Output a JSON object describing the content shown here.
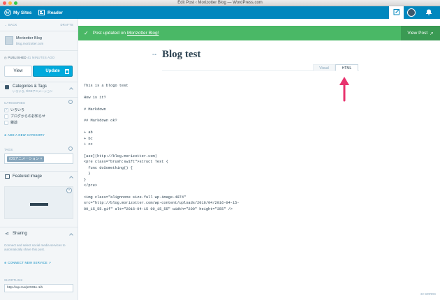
{
  "window": {
    "title": "Edit Post ‹ Morizotter Blog — WordPress.com"
  },
  "masterbar": {
    "my_sites": "My Sites",
    "reader": "Reader"
  },
  "sidebar": {
    "back": "BACK",
    "drafts": "DRAFTS",
    "site_name": "Morizotter Blog",
    "site_url": "blog.morizotter.com",
    "published_label": "PUBLISHED",
    "published_time": "41 MINUTES AGO",
    "view_label": "View",
    "update_label": "Update",
    "categories_title": "Categories & Tags",
    "categories_sub": "いろいろ, #iOSアニメーション",
    "categories_caps": "CATEGORIES",
    "categories": [
      {
        "label": "いろいろ",
        "checked": true
      },
      {
        "label": "ブログからのお知らせ",
        "checked": false
      },
      {
        "label": "雑談",
        "checked": false
      }
    ],
    "add_category": "ADD A NEW CATEGORY",
    "tags_caps": "TAGS",
    "tag": "iOSアニメーション",
    "featured_title": "Featured image",
    "sharing_title": "Sharing",
    "sharing_desc": "Connect and select social media services to automatically share this post.",
    "connect": "CONNECT NEW SERVICE",
    "shortlink_caps": "SHORTLINK",
    "shortlink": "http://wp.me/p2X9tA-1ih"
  },
  "notice": {
    "text": "Post updated on",
    "link": "Morizotter Blog!",
    "view_post": "View Post"
  },
  "editor": {
    "title": "Blog test",
    "tabs": [
      "Visual",
      "HTML"
    ],
    "active_tab": "HTML",
    "word_count": "22 WORDS",
    "content_lines": [
      "This is a blogo test",
      "",
      "How is it?",
      "",
      "# Markdown",
      "",
      "## Markdown ok?",
      "",
      "+ ab",
      "+ bc",
      "+ cc",
      "",
      "[ase](http://blog.morizotter.com)",
      "<pre class=\"brush:swift\">struct Test {",
      "  func doSomething() {",
      "  }",
      "}",
      "</pre>",
      "",
      "<img class=\"alignnone size-full wp-image-4974\"",
      "src=\"http://blog.morizotter.com/wp-content/uploads/2016/04/2016-04-15-",
      "00_15_55.gif\" alt=\"2016-04-15 00_15_55\" width=\"200\" height=\"355\" />"
    ]
  },
  "colors": {
    "masterbar": "#0087be",
    "notice": "#4ab866",
    "arrow": "#e8336e",
    "accent": "#00aadc"
  }
}
